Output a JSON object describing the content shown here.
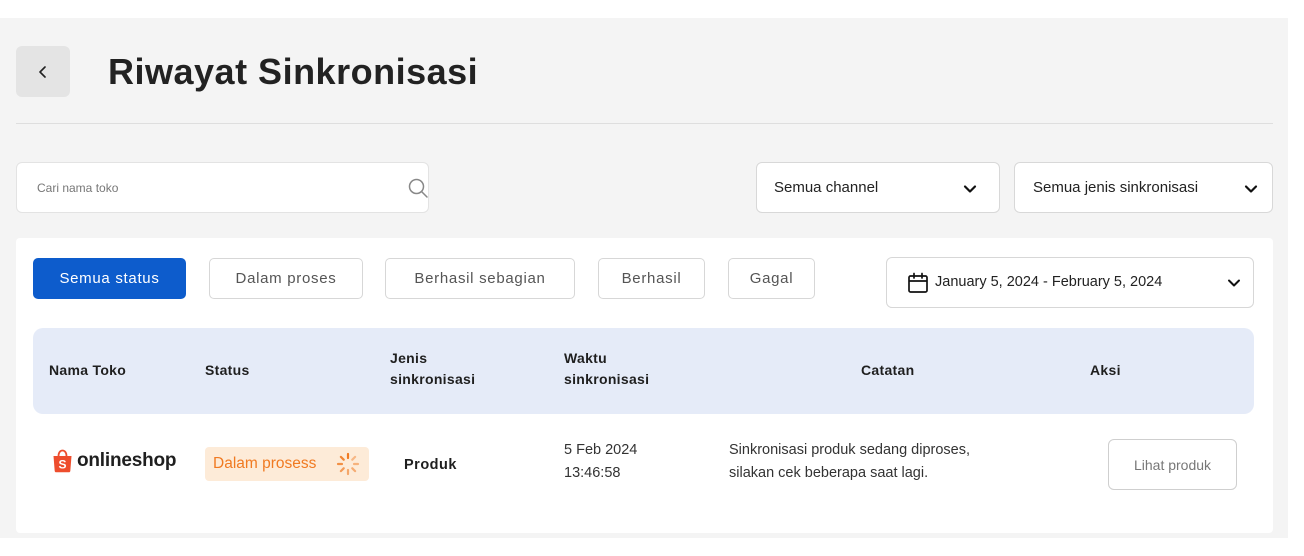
{
  "header": {
    "title": "Riwayat Sinkronisasi",
    "back_icon": "chevron-left-icon"
  },
  "filters": {
    "search_placeholder": "Cari nama toko",
    "search_value": "",
    "channel_selected": "Semua channel",
    "type_selected": "Semua jenis sinkronisasi"
  },
  "status_tabs": [
    {
      "label": "Semua status",
      "active": true
    },
    {
      "label": "Dalam proses",
      "active": false
    },
    {
      "label": "Berhasil sebagian",
      "active": false
    },
    {
      "label": "Berhasil",
      "active": false
    },
    {
      "label": "Gagal",
      "active": false
    }
  ],
  "date_range": {
    "label": "January 5, 2024 - February 5, 2024"
  },
  "table": {
    "columns": [
      {
        "line1": "Nama Toko",
        "line2": ""
      },
      {
        "line1": "Status",
        "line2": ""
      },
      {
        "line1": "Jenis",
        "line2": "sinkronisasi"
      },
      {
        "line1": "Waktu",
        "line2": "sinkronisasi"
      },
      {
        "line1": "Catatan",
        "line2": ""
      },
      {
        "line1": "Aksi",
        "line2": ""
      }
    ],
    "rows": [
      {
        "shop_name": "onlineshop",
        "shop_icon": "shopping-bag-icon",
        "status": "Dalam prosess",
        "type": "Produk",
        "date": "5 Feb 2024",
        "time": "13:46:58",
        "note_line1": "Sinkronisasi produk sedang diproses,",
        "note_line2": "silakan cek beberapa saat lagi.",
        "action": "Lihat produk"
      }
    ]
  },
  "colors": {
    "primary": "#0d5ccc",
    "header_bg": "#e5ebf8",
    "status_bg": "#fdebd8",
    "status_text": "#f07a22",
    "shop_logo": "#ee4d2d"
  }
}
